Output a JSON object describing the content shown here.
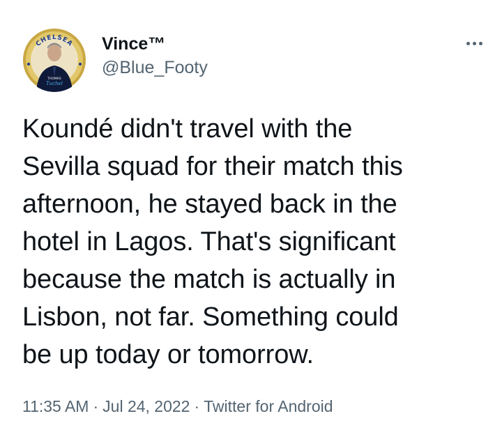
{
  "tweet": {
    "author": {
      "display_name": "Vince™",
      "handle": "@Blue_Footy",
      "avatar_badge_text": "CHELSEA",
      "avatar_caption": "THOMAS",
      "avatar_signature": "Tuchel"
    },
    "more_icon": "more-horizontal-icon",
    "text": "Koundé didn't travel with the\nSevilla squad for their match this\nafternoon, he stayed back in the\nhotel in Lagos. That's significant\nbecause the match is actually in\nLisbon, not far. Something could\nbe up today or tomorrow.",
    "time": "11:35 AM",
    "separator": "·",
    "date": "Jul 24, 2022",
    "source": "Twitter for Android"
  },
  "colors": {
    "text_primary": "#0f1419",
    "text_secondary": "#536471",
    "background": "#ffffff",
    "avatar_gold": "#c9a743",
    "avatar_navy": "#0f1a3a"
  }
}
